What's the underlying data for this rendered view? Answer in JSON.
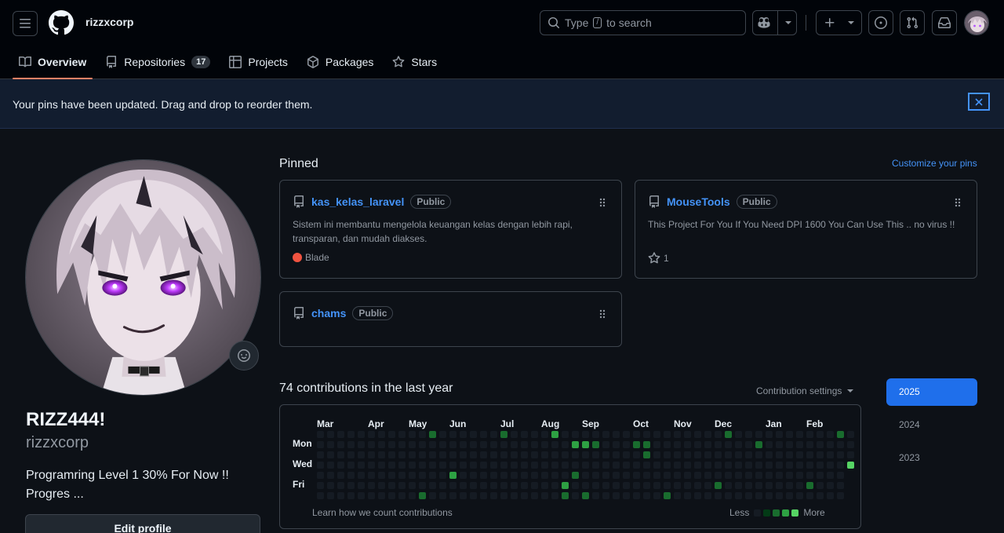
{
  "header": {
    "username": "rizzxcorp",
    "search_placeholder_prefix": "Type",
    "search_key": "/",
    "search_placeholder_suffix": "to search"
  },
  "tabs": [
    {
      "label": "Overview",
      "icon": "book-icon",
      "active": true
    },
    {
      "label": "Repositories",
      "icon": "repo-icon",
      "count": "17"
    },
    {
      "label": "Projects",
      "icon": "table-icon"
    },
    {
      "label": "Packages",
      "icon": "package-icon"
    },
    {
      "label": "Stars",
      "icon": "star-icon"
    }
  ],
  "flash": {
    "message": "Your pins have been updated. Drag and drop to reorder them."
  },
  "profile": {
    "name": "RIZZ444!",
    "login": "rizzxcorp",
    "bio_line1": "Programring Level 1 30% For Now !!",
    "bio_line2": "Progres ...",
    "edit_label": "Edit profile"
  },
  "pinned": {
    "title": "Pinned",
    "customize_label": "Customize your pins",
    "repos": [
      {
        "name": "kas_kelas_laravel",
        "visibility": "Public",
        "description": "Sistem ini membantu mengelola keuangan kelas dengan lebih rapi, transparan, dan mudah diakses.",
        "language": "Blade",
        "language_color": "#f05340"
      },
      {
        "name": "MouseTools",
        "visibility": "Public",
        "description": "This Project For You If You Need DPI 1600 You Can Use This .. no virus !!",
        "stars": "1"
      },
      {
        "name": "chams",
        "visibility": "Public"
      }
    ]
  },
  "contributions": {
    "title": "74 contributions in the last year",
    "settings_label": "Contribution settings",
    "months": [
      "Mar",
      "Apr",
      "May",
      "Jun",
      "Jul",
      "Aug",
      "Sep",
      "Oct",
      "Nov",
      "Dec",
      "Jan",
      "Feb"
    ],
    "days": [
      "Mon",
      "Wed",
      "Fri"
    ],
    "learn_label": "Learn how we count contributions",
    "less_label": "Less",
    "more_label": "More",
    "level_colors": [
      "#151b23",
      "#033a16",
      "#196c2e",
      "#2ea043",
      "#56d364"
    ],
    "active_cells": [
      [
        11,
        0,
        2
      ],
      [
        18,
        0,
        2
      ],
      [
        23,
        0,
        3
      ],
      [
        40,
        0,
        2
      ],
      [
        51,
        0,
        2
      ],
      [
        25,
        1,
        3
      ],
      [
        26,
        1,
        3
      ],
      [
        27,
        1,
        2
      ],
      [
        31,
        1,
        2
      ],
      [
        32,
        1,
        2
      ],
      [
        43,
        1,
        2
      ],
      [
        32,
        2,
        2
      ],
      [
        52,
        3,
        4
      ],
      [
        13,
        4,
        3
      ],
      [
        25,
        4,
        2
      ],
      [
        24,
        5,
        3
      ],
      [
        39,
        5,
        2
      ],
      [
        48,
        5,
        2
      ],
      [
        10,
        6,
        2
      ],
      [
        24,
        6,
        2
      ],
      [
        26,
        6,
        2
      ],
      [
        34,
        6,
        2
      ]
    ]
  },
  "years": [
    "2025",
    "2024",
    "2023"
  ]
}
